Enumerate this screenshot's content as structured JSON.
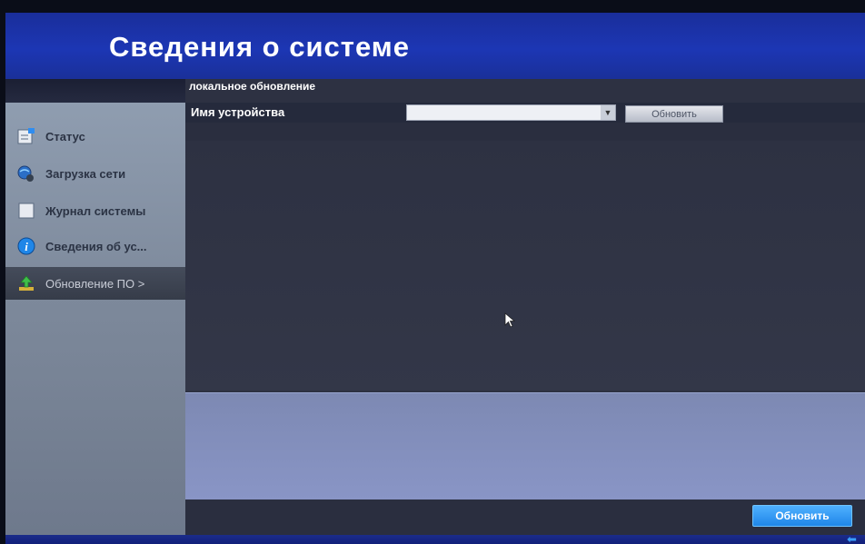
{
  "header": {
    "title": "Сведения о системе"
  },
  "sidebar": {
    "items": [
      {
        "label": "Статус",
        "icon": "status-icon"
      },
      {
        "label": "Загрузка сети",
        "icon": "network-icon"
      },
      {
        "label": "Журнал системы",
        "icon": "log-icon"
      },
      {
        "label": "Сведения об ус...",
        "icon": "info-icon"
      },
      {
        "label": "Обновление ПО >",
        "icon": "upgrade-icon",
        "active": true
      }
    ]
  },
  "main": {
    "section_title": "локальное обновление",
    "device_label": "Имя устройства",
    "device_select_value": "",
    "refresh_label": "Обновить",
    "columns": [
      "",
      "",
      "",
      ""
    ],
    "upgrade_label": "Обновить"
  },
  "colors": {
    "header_blue": "#1c36b4",
    "accent_button": "#1f86e8",
    "panel": "#8995c6"
  }
}
